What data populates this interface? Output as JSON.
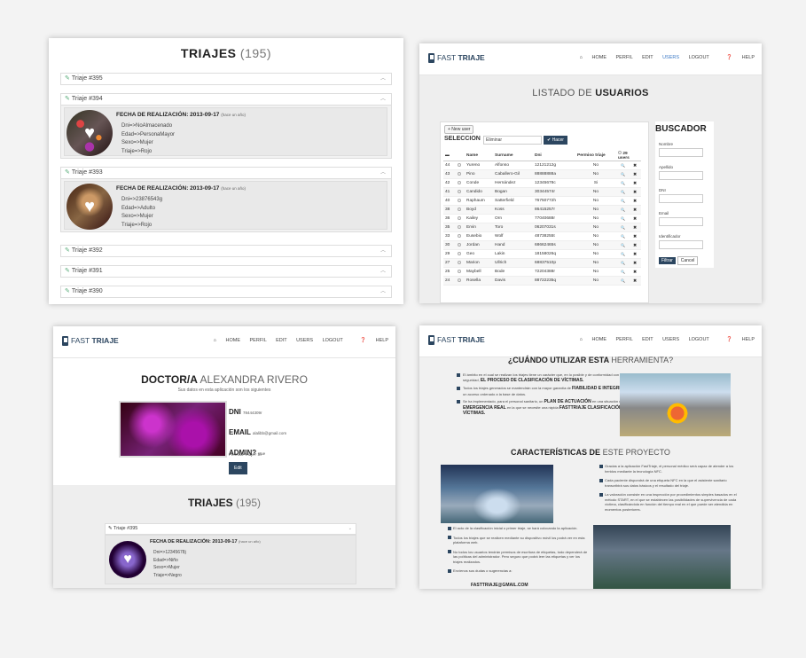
{
  "panel1": {
    "title": "TRIAJES",
    "count": "(195)",
    "items": [
      {
        "label": "Triaje #395"
      },
      {
        "label": "Triaje #394",
        "expanded": true,
        "fecha_label": "FECHA DE REALIZACIÓN: 2013-09-17",
        "fecha_small": "(hace un año)",
        "dni": "Dni=>NoAlmacenado",
        "edad": "Edad=>PersonaMayor",
        "sexo": "Sexo=>Mujer",
        "triaje": "Triaje=>Rojo"
      },
      {
        "label": "Triaje #393",
        "expanded": true,
        "fecha_label": "FECHA DE REALIZACIÓN: 2013-09-17",
        "fecha_small": "(hace un año)",
        "dni": "Dni=>23876543g",
        "edad": "Edad=>Adulto",
        "sexo": "Sexo=>Mujer",
        "triaje": "Triaje=>Rojo"
      },
      {
        "label": "Triaje #392"
      },
      {
        "label": "Triaje #391"
      },
      {
        "label": "Triaje #390"
      }
    ]
  },
  "nav": {
    "brand_light": "FAST",
    "brand_bold": "TRIAJE",
    "home": "HOME",
    "perfil": "PERFIL",
    "edit": "EDIT",
    "users": "USERS",
    "logout": "LOGOUT",
    "help": "HELP"
  },
  "panel2": {
    "heading_light": "LISTADO DE",
    "heading_bold": "USUARIOS",
    "new_user": "+ New user",
    "seleccion": "SELECCION",
    "select_value": "Eliminar",
    "hacer": "✔ Hacer",
    "columns": [
      "Name",
      "Surname",
      "Dni",
      "Permiso triaje",
      "29 users"
    ],
    "rows": [
      {
        "id": "44",
        "name": "Yureno",
        "surname": "Alfonso",
        "dni": "12121212g",
        "permiso": "No"
      },
      {
        "id": "43",
        "name": "Pino",
        "surname": "Caballero-Gil",
        "dni": "88888888a",
        "permiso": "No"
      },
      {
        "id": "42",
        "name": "Conde",
        "surname": "Hernández",
        "dni": "12345678c",
        "permiso": "Si"
      },
      {
        "id": "41",
        "name": "Candido",
        "surname": "Bogan",
        "dni": "30344574r",
        "permiso": "No"
      },
      {
        "id": "40",
        "name": "Raphaum",
        "surname": "Satterfield",
        "dni": "76750772h",
        "permiso": "No"
      },
      {
        "id": "38",
        "name": "Boyd",
        "surname": "Koss",
        "dni": "86415257r",
        "permiso": "No"
      },
      {
        "id": "36",
        "name": "Kailey",
        "surname": "Orn",
        "dni": "77040688r",
        "permiso": "No"
      },
      {
        "id": "35",
        "name": "Ervin",
        "surname": "Toro",
        "dni": "06207031s",
        "permiso": "No"
      },
      {
        "id": "33",
        "name": "Eusebio",
        "surname": "Wolf",
        "dni": "48738255t",
        "permiso": "No"
      },
      {
        "id": "30",
        "name": "Jordan",
        "surname": "Hand",
        "dni": "68662465s",
        "permiso": "No"
      },
      {
        "id": "29",
        "name": "Geo",
        "surname": "Lakin",
        "dni": "18158026q",
        "permiso": "No"
      },
      {
        "id": "27",
        "name": "Marion",
        "surname": "Ullrich",
        "dni": "68837510p",
        "permiso": "No"
      },
      {
        "id": "25",
        "name": "Maybell",
        "surname": "Bode",
        "dni": "72204388r",
        "permiso": "No"
      },
      {
        "id": "24",
        "name": "Rosella",
        "surname": "Davis",
        "dni": "88722235q",
        "permiso": "No"
      }
    ],
    "buscador": {
      "title": "BUSCADOR",
      "nombre": "Nombre",
      "apellido": "Apellido",
      "dni": "DNI",
      "email": "Email",
      "identificador": "Identificador",
      "filtrar": "Filtrar",
      "cancel": "Cancel"
    }
  },
  "panel3": {
    "doctor_bold": "DOCTOR/A",
    "doctor_name": "ALEXANDRA RIVERO",
    "subtitle": "Sus datos en esta aplicación son los siguientes",
    "dni_label": "DNI",
    "dni_value": "78444309r",
    "email_label": "EMAIL",
    "email_value": "alalibb@gmail.com",
    "admin_label": "ADMIN?",
    "admin_value": "true",
    "permiso": "Permiso Triaje? Sí",
    "edit": "Edit",
    "triajes": "TRIAJES",
    "count": "(195)",
    "item_label": "Triaje #395",
    "fecha_label": "FECHA DE REALIZACIÓN: 2013-09-17",
    "fecha_small": "(hace un año)",
    "dni": "Dni=>12345678j",
    "edad": "Edad=>Niño",
    "sexo": "Sexo=>Mujer",
    "triaje": "Triaje=>Negro"
  },
  "panel4": {
    "h1_bold": "¿CUÁNDO UTILIZAR ESTA",
    "h1_thin": "HERRAMIENTA?",
    "bullet1_text": "El ámbito en el cual se realizan los triajes tiene un carácter que, en lo posible y de conformidad con los requisitos de seguridad,",
    "bullet1_strong": "EL PROCESO DE CLASIFICACIÓN DE VÍCTIMAS.",
    "bullet2_text": "Todos los triajes generados se mantendrán con la mayor garantía de",
    "bullet2_strong": "FIABILIDAD E INTEGRIDAD",
    "bullet2_tail": ", permitiendo un acceso ordenado a la base de datos.",
    "bullet3_text": "Se ha implementado, para el personal sanitario, un",
    "bullet3_strong": "PLAN DE ACTUACIÓN",
    "bullet3_mid": "en una situación de",
    "bullet3_strong2": "EMERGENCIA REAL",
    "bullet3_tail": "en la que se necesite una rápida",
    "bullet3_strong3": "CLASIFICACIÓN DE VÍCTIMAS.",
    "bullet3_brand": "FASTTRIAJE",
    "h2_bold": "CARACTERÍSTICAS DE",
    "h2_thin": "ESTE PROYECTO",
    "feat_r": [
      "Gracias a la aplicación FastTriaje, el personal médico será capaz de atender a los heridos mediante la tecnología NFC.",
      "Cada paciente dispondrá de una etiqueta NFC en la que el asistente sanitario transcribirá sus datos básicos y el resultado del triaje.",
      "La valoración consiste en una inspección por procedimientos simples basados en el método START, en el que se establecen las posibilidades de supervivencia de cada víctima, clasificándola en función del tiempo real en el que puede ser atendida en momentos posteriores."
    ],
    "feat_l": [
      "El acto de la clasificación inicial o primer triaje, se hará colocando la aplicación.",
      "Todos los triajes que se realicen mediante su dispositivo móvil los podrá ver en esta plataforma web.",
      "No todos los usuarios tendrán permisos de escritura de etiquetas, todo dependerá de las políticas del administrador. Pero seguro que podrá leer las etiquetas y ver los triajes realizados.",
      "Envíenos sus dudas o sugerencias a:"
    ],
    "email": "FASTTRIAJE@GMAIL.COM"
  }
}
